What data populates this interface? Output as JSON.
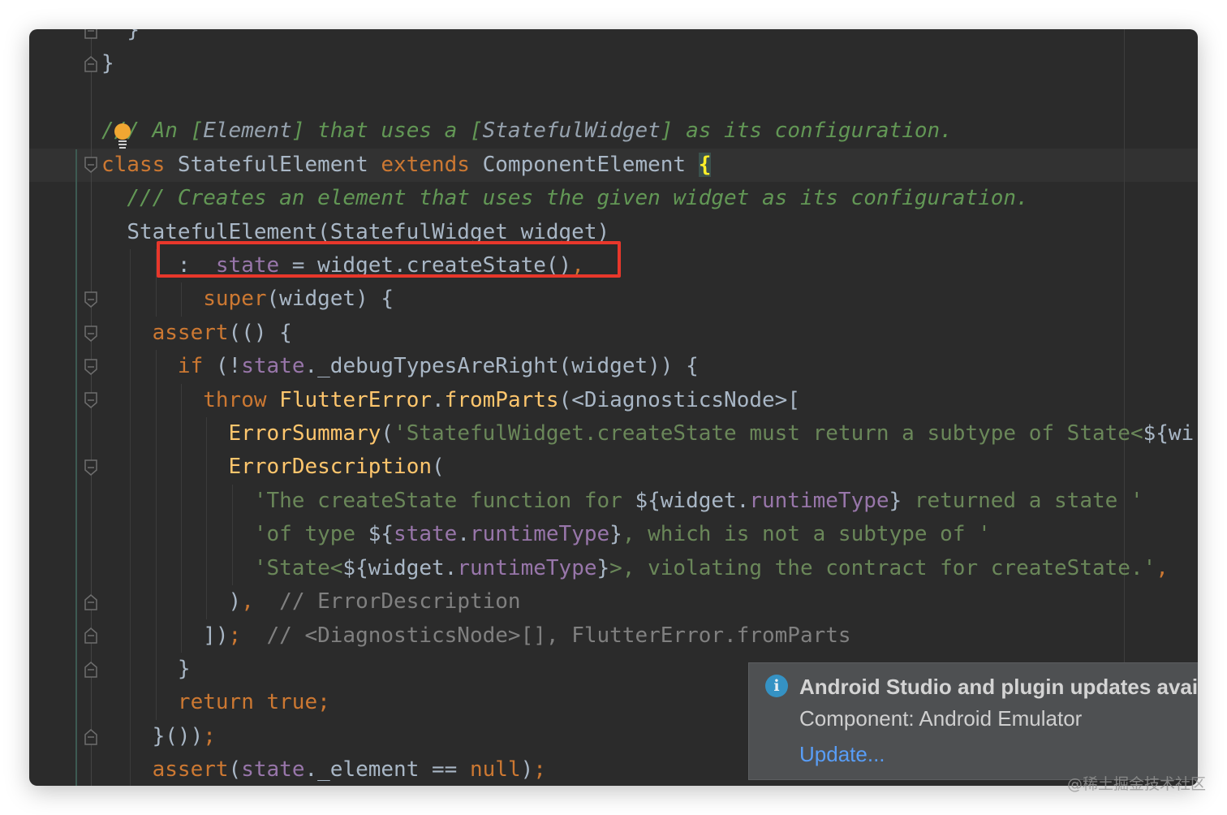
{
  "editor": {
    "lines": [
      {
        "indent": 2,
        "fold": "end",
        "tokens": [
          {
            "t": "}",
            "c": ""
          }
        ]
      },
      {
        "indent": 0,
        "fold": "end",
        "tokens": [
          {
            "t": "}",
            "c": ""
          }
        ]
      },
      {
        "indent": 0,
        "tokens": []
      },
      {
        "indent": 0,
        "tokens": [
          {
            "t": "/// An ",
            "c": "doc"
          },
          {
            "t": "[",
            "c": "doc"
          },
          {
            "t": "Element",
            "c": "docref"
          },
          {
            "t": "]",
            "c": "doc"
          },
          {
            "t": " that uses a ",
            "c": "doc"
          },
          {
            "t": "[",
            "c": "doc"
          },
          {
            "t": "StatefulWidget",
            "c": "docref"
          },
          {
            "t": "]",
            "c": "doc"
          },
          {
            "t": " as its configuration.",
            "c": "doc"
          }
        ]
      },
      {
        "indent": 0,
        "fold": "start",
        "tokens": [
          {
            "t": "class",
            "c": "kw"
          },
          {
            "t": " StatefulElement ",
            "c": ""
          },
          {
            "t": "extends",
            "c": "kw"
          },
          {
            "t": " ComponentElement ",
            "c": ""
          },
          {
            "t": "{",
            "c": "brace"
          }
        ]
      },
      {
        "indent": 2,
        "tokens": [
          {
            "t": "/// Creates an element that uses the given widget as its configuration.",
            "c": "doc"
          }
        ]
      },
      {
        "indent": 2,
        "tokens": [
          {
            "t": "StatefulElement(StatefulWidget widget)",
            "c": ""
          }
        ]
      },
      {
        "indent": 6,
        "tokens": [
          {
            "t": ": ",
            "c": ""
          },
          {
            "t": "_state",
            "c": "fld"
          },
          {
            "t": " = widget.createState()",
            "c": ""
          },
          {
            "t": ",",
            "c": "kw"
          }
        ]
      },
      {
        "indent": 8,
        "fold": "start",
        "tokens": [
          {
            "t": "super",
            "c": "kw"
          },
          {
            "t": "(widget) {",
            "c": ""
          }
        ]
      },
      {
        "indent": 4,
        "fold": "start",
        "tokens": [
          {
            "t": "assert",
            "c": "kw"
          },
          {
            "t": "(() {",
            "c": ""
          }
        ]
      },
      {
        "indent": 6,
        "fold": "start",
        "tokens": [
          {
            "t": "if",
            "c": "kw"
          },
          {
            "t": " (!",
            "c": ""
          },
          {
            "t": "state",
            "c": "fld"
          },
          {
            "t": "._debugTypesAreRight(widget)) {",
            "c": ""
          }
        ]
      },
      {
        "indent": 8,
        "fold": "start",
        "tokens": [
          {
            "t": "throw",
            "c": "kw"
          },
          {
            "t": " ",
            "c": ""
          },
          {
            "t": "FlutterError",
            "c": "fn"
          },
          {
            "t": ".",
            "c": ""
          },
          {
            "t": "fromParts",
            "c": "fn"
          },
          {
            "t": "(<DiagnosticsNode>[",
            "c": ""
          }
        ]
      },
      {
        "indent": 10,
        "tokens": [
          {
            "t": "ErrorSummary",
            "c": "fn"
          },
          {
            "t": "(",
            "c": ""
          },
          {
            "t": "'StatefulWidget.createState must return a subtype of State<",
            "c": "str"
          },
          {
            "t": "${wi",
            "c": ""
          }
        ]
      },
      {
        "indent": 10,
        "fold": "start",
        "tokens": [
          {
            "t": "ErrorDescription",
            "c": "fn"
          },
          {
            "t": "(",
            "c": ""
          }
        ]
      },
      {
        "indent": 12,
        "tokens": [
          {
            "t": "'The createState function for ",
            "c": "str"
          },
          {
            "t": "${widget.",
            "c": ""
          },
          {
            "t": "runtimeType",
            "c": "fld"
          },
          {
            "t": "}",
            "c": ""
          },
          {
            "t": " returned a state '",
            "c": "str"
          }
        ]
      },
      {
        "indent": 12,
        "tokens": [
          {
            "t": "'of type ",
            "c": "str"
          },
          {
            "t": "${",
            "c": ""
          },
          {
            "t": "state",
            "c": "fld"
          },
          {
            "t": ".",
            "c": ""
          },
          {
            "t": "runtimeType",
            "c": "fld"
          },
          {
            "t": "}",
            "c": ""
          },
          {
            "t": ", which is not a subtype of '",
            "c": "str"
          }
        ]
      },
      {
        "indent": 12,
        "tokens": [
          {
            "t": "'State<",
            "c": "str"
          },
          {
            "t": "${widget.",
            "c": ""
          },
          {
            "t": "runtimeType",
            "c": "fld"
          },
          {
            "t": "}",
            "c": ""
          },
          {
            "t": ">, violating the contract for createState.'",
            "c": "str"
          },
          {
            "t": ",",
            "c": "kw"
          }
        ]
      },
      {
        "indent": 10,
        "fold": "end",
        "tokens": [
          {
            "t": ")",
            "c": ""
          },
          {
            "t": ",",
            "c": "kw"
          },
          {
            "t": "  // ErrorDescription",
            "c": "cmt"
          }
        ]
      },
      {
        "indent": 8,
        "fold": "end",
        "tokens": [
          {
            "t": "])",
            "c": ""
          },
          {
            "t": ";",
            "c": "kw"
          },
          {
            "t": "  // <DiagnosticsNode>[], FlutterError.fromParts",
            "c": "cmt"
          }
        ]
      },
      {
        "indent": 6,
        "fold": "end",
        "tokens": [
          {
            "t": "}",
            "c": ""
          }
        ]
      },
      {
        "indent": 6,
        "tokens": [
          {
            "t": "return",
            "c": "kw"
          },
          {
            "t": " ",
            "c": ""
          },
          {
            "t": "true",
            "c": "kw"
          },
          {
            "t": ";",
            "c": "kw"
          }
        ]
      },
      {
        "indent": 4,
        "fold": "end",
        "tokens": [
          {
            "t": "}())",
            "c": ""
          },
          {
            "t": ";",
            "c": "kw"
          }
        ]
      },
      {
        "indent": 4,
        "tokens": [
          {
            "t": "assert",
            "c": "kw"
          },
          {
            "t": "(",
            "c": ""
          },
          {
            "t": "state",
            "c": "fld"
          },
          {
            "t": "._element ",
            "c": ""
          },
          {
            "t": "==",
            "c": ""
          },
          {
            "t": " ",
            "c": ""
          },
          {
            "t": "null",
            "c": "kw"
          },
          {
            "t": ")",
            "c": ""
          },
          {
            "t": ";",
            "c": "kw"
          }
        ]
      }
    ],
    "highlight_color": "#e8372b",
    "intention_icon": "lightbulb-icon"
  },
  "notification": {
    "icon": "info-icon",
    "title": "Android Studio and plugin updates available",
    "body": "Component: Android Emulator",
    "action": "Update..."
  },
  "watermark": "@稀土掘金技术社区"
}
